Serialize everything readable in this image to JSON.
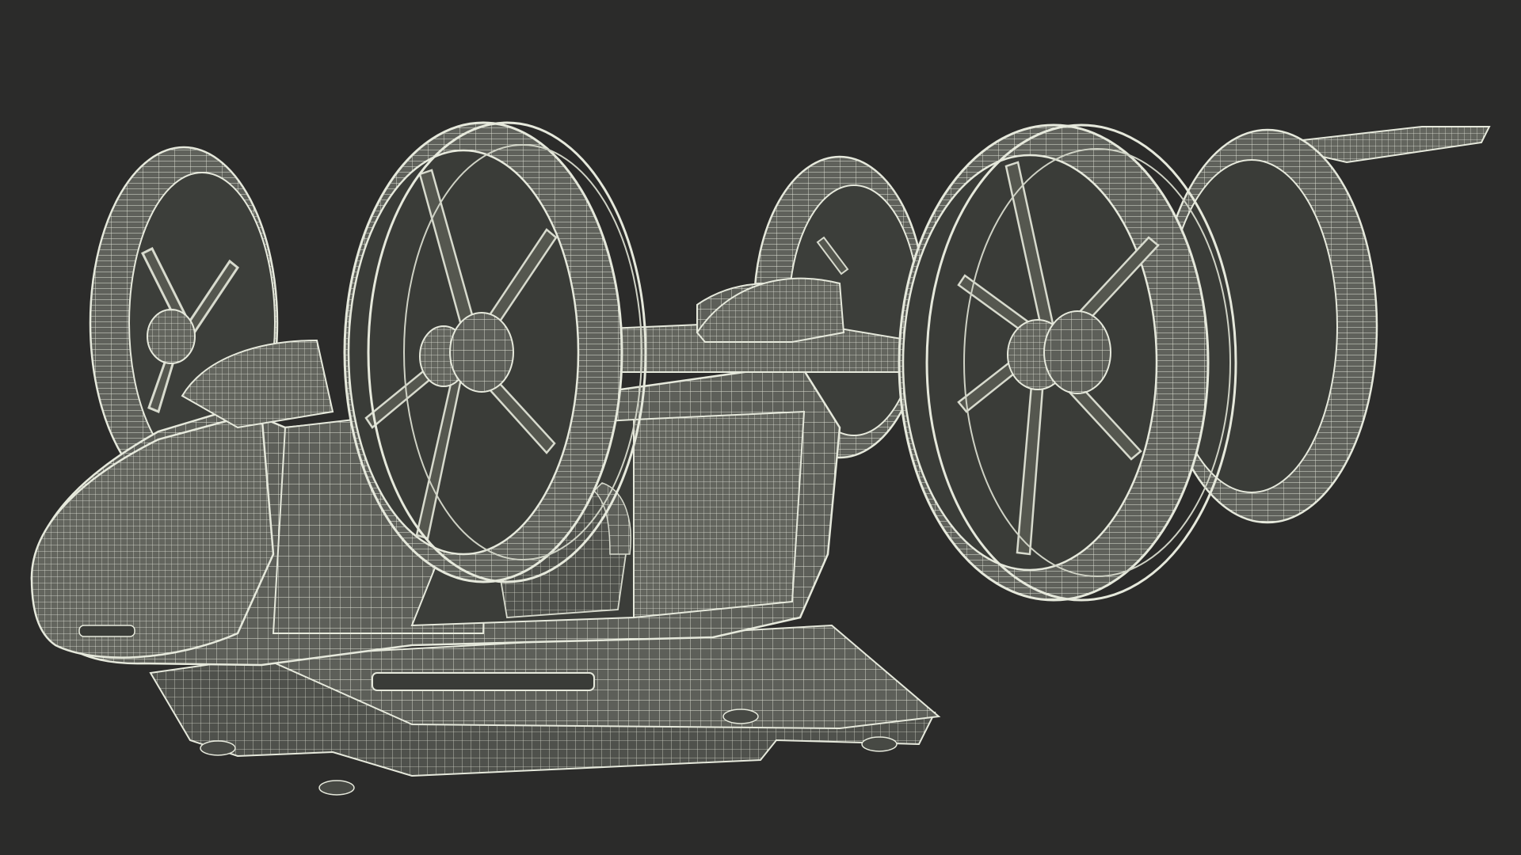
{
  "viewport": {
    "background_color": "#2b2b2a",
    "model": {
      "shading": "wireframe-on-shaded",
      "surface_color": "#5d5f59",
      "surface_light_color": "#6a6c65",
      "surface_dark_color": "#474944",
      "wire_color": "#e6e9dc",
      "wire_minor_color": "#c9ccc0",
      "components": [
        "fuselage",
        "cockpit-nose",
        "canopy",
        "side-door",
        "cabin-seat",
        "landing-skid",
        "tail-wing",
        "ducted-fan-front-left",
        "ducted-fan-rear-left",
        "ducted-fan-front-right",
        "ducted-fan-rear-right"
      ]
    }
  }
}
